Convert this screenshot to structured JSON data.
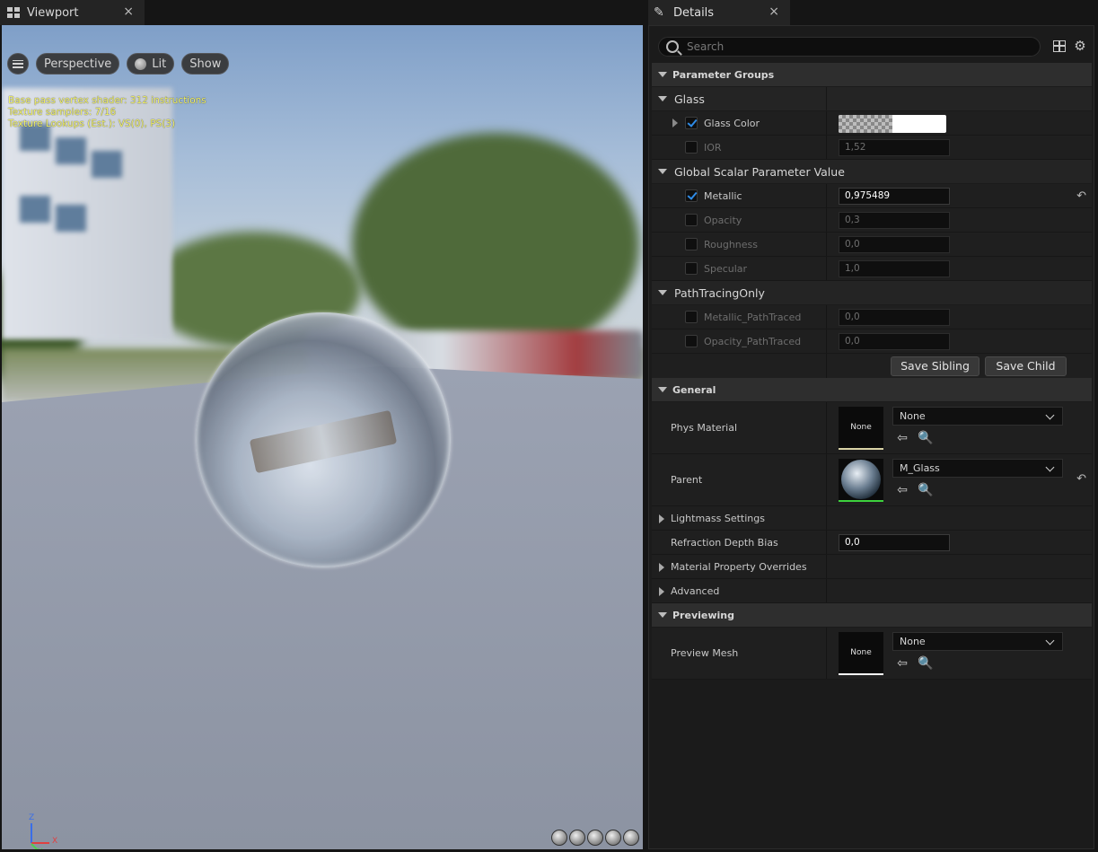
{
  "viewport_tab": {
    "title": "Viewport",
    "close": "×"
  },
  "details_tab": {
    "title": "Details",
    "close": "×"
  },
  "viewport": {
    "toolbar": {
      "perspective": "Perspective",
      "lit": "Lit",
      "show": "Show"
    },
    "stats": [
      "Base pass vertex shader: 312 instructions",
      "Texture samplers: 7/16",
      "Texture Lookups (Est.): VS(0), PS(3)"
    ],
    "axis": {
      "z": "Z",
      "x": "X",
      "y": "Y"
    }
  },
  "details": {
    "search_placeholder": "Search",
    "sections": {
      "parameter_groups": "Parameter Groups",
      "general": "General",
      "previewing": "Previewing"
    },
    "groups": {
      "glass": "Glass",
      "global_scalar": "Global Scalar Parameter Value",
      "path_tracing": "PathTracingOnly"
    },
    "params": {
      "glass_color": {
        "label": "Glass Color",
        "checked": true
      },
      "ior": {
        "label": "IOR",
        "value": "1,52",
        "checked": false
      },
      "metallic": {
        "label": "Metallic",
        "value": "0,975489",
        "checked": true
      },
      "opacity": {
        "label": "Opacity",
        "value": "0,3",
        "checked": false
      },
      "roughness": {
        "label": "Roughness",
        "value": "0,0",
        "checked": false
      },
      "specular": {
        "label": "Specular",
        "value": "1,0",
        "checked": false
      },
      "metallic_pt": {
        "label": "Metallic_PathTraced",
        "value": "0,0",
        "checked": false
      },
      "opacity_pt": {
        "label": "Opacity_PathTraced",
        "value": "0,0",
        "checked": false
      }
    },
    "buttons": {
      "save_sibling": "Save Sibling",
      "save_child": "Save Child"
    },
    "general": {
      "phys_material": {
        "label": "Phys Material",
        "thumb": "None",
        "value": "None"
      },
      "parent": {
        "label": "Parent",
        "value": "M_Glass"
      },
      "lightmass": "Lightmass Settings",
      "refraction": {
        "label": "Refraction Depth Bias",
        "value": "0,0"
      },
      "overrides": "Material Property Overrides",
      "advanced": "Advanced"
    },
    "previewing": {
      "preview_mesh": {
        "label": "Preview Mesh",
        "thumb": "None",
        "value": "None"
      }
    }
  },
  "colors": {
    "accent": "#2f8be6",
    "stats_text": "#f4f46a",
    "parent_border": "#3dd13d"
  }
}
